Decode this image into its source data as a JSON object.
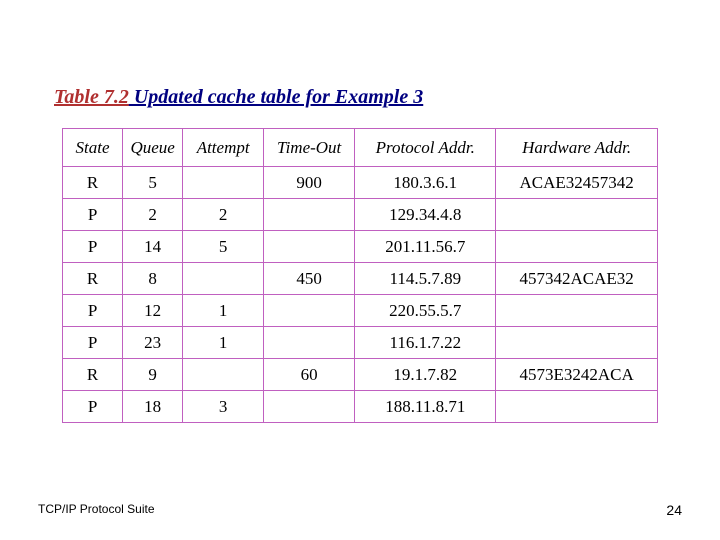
{
  "caption": {
    "prefix": "Table 7.2",
    "rest": "  Updated cache table for Example 3"
  },
  "headers": {
    "state": "State",
    "queue": "Queue",
    "attempt": "Attempt",
    "timeout": "Time-Out",
    "paddr": "Protocol Addr.",
    "haddr": "Hardware Addr."
  },
  "chart_data": {
    "type": "table",
    "columns": [
      "State",
      "Queue",
      "Attempt",
      "Time-Out",
      "Protocol Addr.",
      "Hardware Addr."
    ],
    "rows": [
      {
        "state": "R",
        "queue": "5",
        "attempt": "",
        "timeout": "900",
        "paddr": "180.3.6.1",
        "haddr": "ACAE32457342"
      },
      {
        "state": "P",
        "queue": "2",
        "attempt": "2",
        "timeout": "",
        "paddr": "129.34.4.8",
        "haddr": ""
      },
      {
        "state": "P",
        "queue": "14",
        "attempt": "5",
        "timeout": "",
        "paddr": "201.11.56.7",
        "haddr": ""
      },
      {
        "state": "R",
        "queue": "8",
        "attempt": "",
        "timeout": "450",
        "paddr": "114.5.7.89",
        "haddr": "457342ACAE32"
      },
      {
        "state": "P",
        "queue": "12",
        "attempt": "1",
        "timeout": "",
        "paddr": "220.55.5.7",
        "haddr": ""
      },
      {
        "state": "P",
        "queue": "23",
        "attempt": "1",
        "timeout": "",
        "paddr": "116.1.7.22",
        "haddr": ""
      },
      {
        "state": "R",
        "queue": "9",
        "attempt": "",
        "timeout": "60",
        "paddr": "19.1.7.82",
        "haddr": "4573E3242ACA"
      },
      {
        "state": "P",
        "queue": "18",
        "attempt": "3",
        "timeout": "",
        "paddr": "188.11.8.71",
        "haddr": ""
      }
    ]
  },
  "footer": {
    "left": "TCP/IP Protocol Suite",
    "right": "24"
  }
}
